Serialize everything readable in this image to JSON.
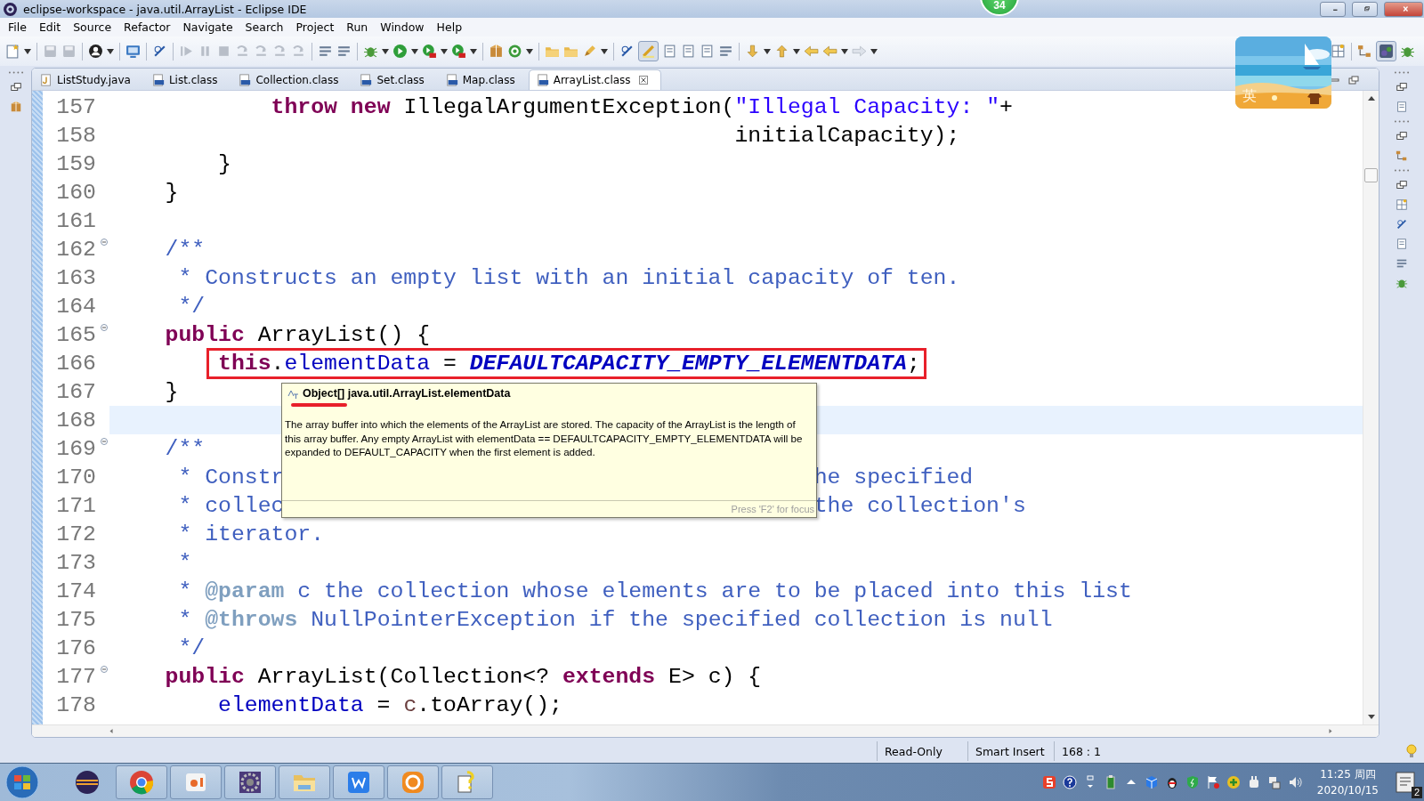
{
  "window": {
    "title": "eclipse-workspace - java.util.ArrayList - Eclipse IDE",
    "badge": "34"
  },
  "menu": [
    "File",
    "Edit",
    "Source",
    "Refactor",
    "Navigate",
    "Search",
    "Project",
    "Run",
    "Window",
    "Help"
  ],
  "ime_widget": {
    "label": "英"
  },
  "tabs": [
    {
      "label": "ListStudy.java",
      "kind": "java",
      "selected": false
    },
    {
      "label": "List.class",
      "kind": "class",
      "selected": false
    },
    {
      "label": "Collection.class",
      "kind": "class",
      "selected": false
    },
    {
      "label": "Set.class",
      "kind": "class",
      "selected": false
    },
    {
      "label": "Map.class",
      "kind": "class",
      "selected": false
    },
    {
      "label": "ArrayList.class",
      "kind": "class",
      "selected": true
    }
  ],
  "editor": {
    "lines": [
      {
        "number": "157",
        "tokens": [
          {
            "kind": "kw",
            "t": "            throw"
          },
          {
            "kind": "kw",
            "t": " new"
          },
          {
            "kind": "plain",
            "t": " IllegalArgumentException("
          },
          {
            "kind": "str",
            "t": "\"Illegal Capacity: \""
          },
          {
            "kind": "plain",
            "t": "+"
          }
        ]
      },
      {
        "number": "158",
        "tokens": [
          {
            "kind": "plain",
            "t": "                                               initialCapacity);"
          }
        ]
      },
      {
        "number": "159",
        "tokens": [
          {
            "kind": "plain",
            "t": "        }"
          }
        ]
      },
      {
        "number": "160",
        "tokens": [
          {
            "kind": "plain",
            "t": "    }"
          }
        ]
      },
      {
        "number": "161"
      },
      {
        "number": "162",
        "foldable": true,
        "tokens": [
          {
            "kind": "comment",
            "t": "    /**"
          }
        ]
      },
      {
        "number": "163",
        "tokens": [
          {
            "kind": "comment",
            "t": "     * Constructs an empty list with an initial capacity of ten."
          }
        ]
      },
      {
        "number": "164",
        "tokens": [
          {
            "kind": "comment",
            "t": "     */"
          }
        ]
      },
      {
        "number": "165",
        "foldable": true,
        "tokens": [
          {
            "kind": "kw",
            "t": "    public"
          },
          {
            "kind": "plain",
            "t": " ArrayList() {"
          }
        ]
      },
      {
        "number": "166",
        "boxed": true,
        "tokens": [
          {
            "kind": "kw",
            "t": "        this"
          },
          {
            "kind": "plain",
            "t": "."
          },
          {
            "kind": "field",
            "t": "elementData"
          },
          {
            "kind": "plain",
            "t": " = "
          },
          {
            "kind": "static",
            "t": "DEFAULTCAPACITY_EMPTY_ELEMENTDATA"
          },
          {
            "kind": "plain",
            "t": ";"
          }
        ]
      },
      {
        "number": "167",
        "tokens": [
          {
            "kind": "plain",
            "t": "    }"
          }
        ]
      },
      {
        "number": "168",
        "current": true
      },
      {
        "number": "169",
        "foldable": true,
        "tokens": [
          {
            "kind": "comment",
            "t": "    /**"
          }
        ]
      },
      {
        "number": "170",
        "tokens": [
          {
            "kind": "comment",
            "t": "     * Constr"
          },
          {
            "kind": "covered"
          },
          {
            "kind": "comment",
            "t": "he specified"
          }
        ]
      },
      {
        "number": "171",
        "tokens": [
          {
            "kind": "comment",
            "t": "     * collec"
          },
          {
            "kind": "covered"
          },
          {
            "kind": "comment",
            "t": "the collection's"
          }
        ]
      },
      {
        "number": "172",
        "tokens": [
          {
            "kind": "comment",
            "t": "     * iterator."
          }
        ]
      },
      {
        "number": "173",
        "tokens": [
          {
            "kind": "comment",
            "t": "     *"
          }
        ]
      },
      {
        "number": "174",
        "tokens": [
          {
            "kind": "comment",
            "t": "     * "
          },
          {
            "kind": "tag",
            "t": "@param"
          },
          {
            "kind": "comment",
            "t": " c the collection whose elements are to be placed into this list"
          }
        ]
      },
      {
        "number": "175",
        "tokens": [
          {
            "kind": "comment",
            "t": "     * "
          },
          {
            "kind": "tag",
            "t": "@throws"
          },
          {
            "kind": "comment",
            "t": " NullPointerException if the specified collection is null"
          }
        ]
      },
      {
        "number": "176",
        "tokens": [
          {
            "kind": "comment",
            "t": "     */"
          }
        ]
      },
      {
        "number": "177",
        "foldable": true,
        "tokens": [
          {
            "kind": "kw",
            "t": "    public"
          },
          {
            "kind": "plain",
            "t": " ArrayList(Collection<? "
          },
          {
            "kind": "kw",
            "t": "extends"
          },
          {
            "kind": "plain",
            "t": " E> c) {"
          }
        ]
      },
      {
        "number": "178",
        "tokens": [
          {
            "kind": "field",
            "t": "        elementData"
          },
          {
            "kind": "plain",
            "t": " = "
          },
          {
            "kind": "local",
            "t": "c"
          },
          {
            "kind": "plain",
            "t": ".toArray();"
          }
        ]
      }
    ]
  },
  "tooltip": {
    "signature": "Object[] java.util.ArrayList.elementData",
    "underlined": true,
    "text": "The array buffer into which the elements of the ArrayList are stored. The capacity of the ArrayList is the length of this array buffer. Any empty ArrayList with elementData == DEFAULTCAPACITY_EMPTY_ELEMENTDATA will be expanded to DEFAULT_CAPACITY when the first element is added.",
    "footer": "Press 'F2' for focus"
  },
  "status_bar": {
    "cells": [
      "Read-Only",
      "Smart Insert",
      "168 : 1"
    ]
  },
  "taskbar": {
    "clock_time": "11:25 周四",
    "clock_date": "2020/10/15",
    "notification_count": "2"
  }
}
